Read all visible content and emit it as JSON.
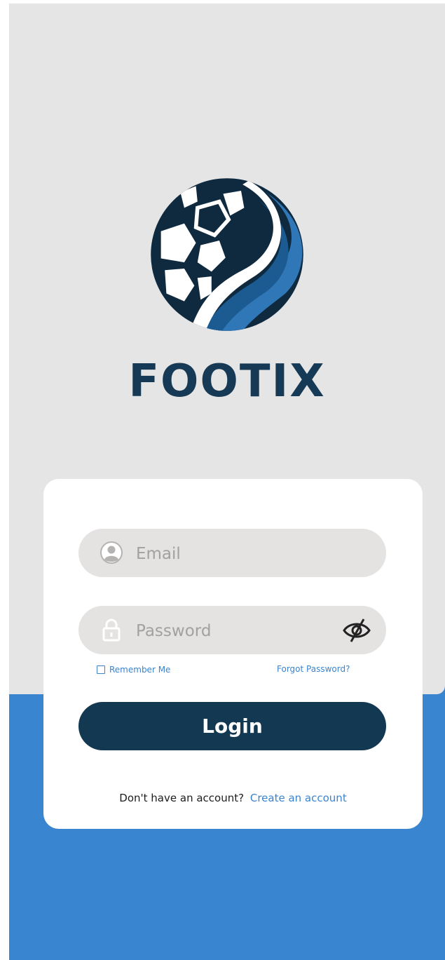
{
  "app": {
    "brand_name": "FOOTIX",
    "logo_icon": "soccer-ball-logo"
  },
  "login_form": {
    "email": {
      "placeholder": "Email",
      "value": "",
      "icon": "user-circle-icon"
    },
    "password": {
      "placeholder": "Password",
      "value": "",
      "icon": "lock-icon",
      "toggle_icon": "eye-slash-icon"
    },
    "remember_me": {
      "label": "Remember Me",
      "checked": false
    },
    "forgot_password_label": "Forgot Password?",
    "login_label": "Login",
    "no_account_text": "Don't have an account?",
    "create_account_label": "Create an account"
  },
  "colors": {
    "top_background": "#e6e5e6",
    "bottom_background": "#3a85cf",
    "brand_navy": "#133852",
    "link_blue": "#3a84cf",
    "field_background": "#e5e2e2"
  }
}
